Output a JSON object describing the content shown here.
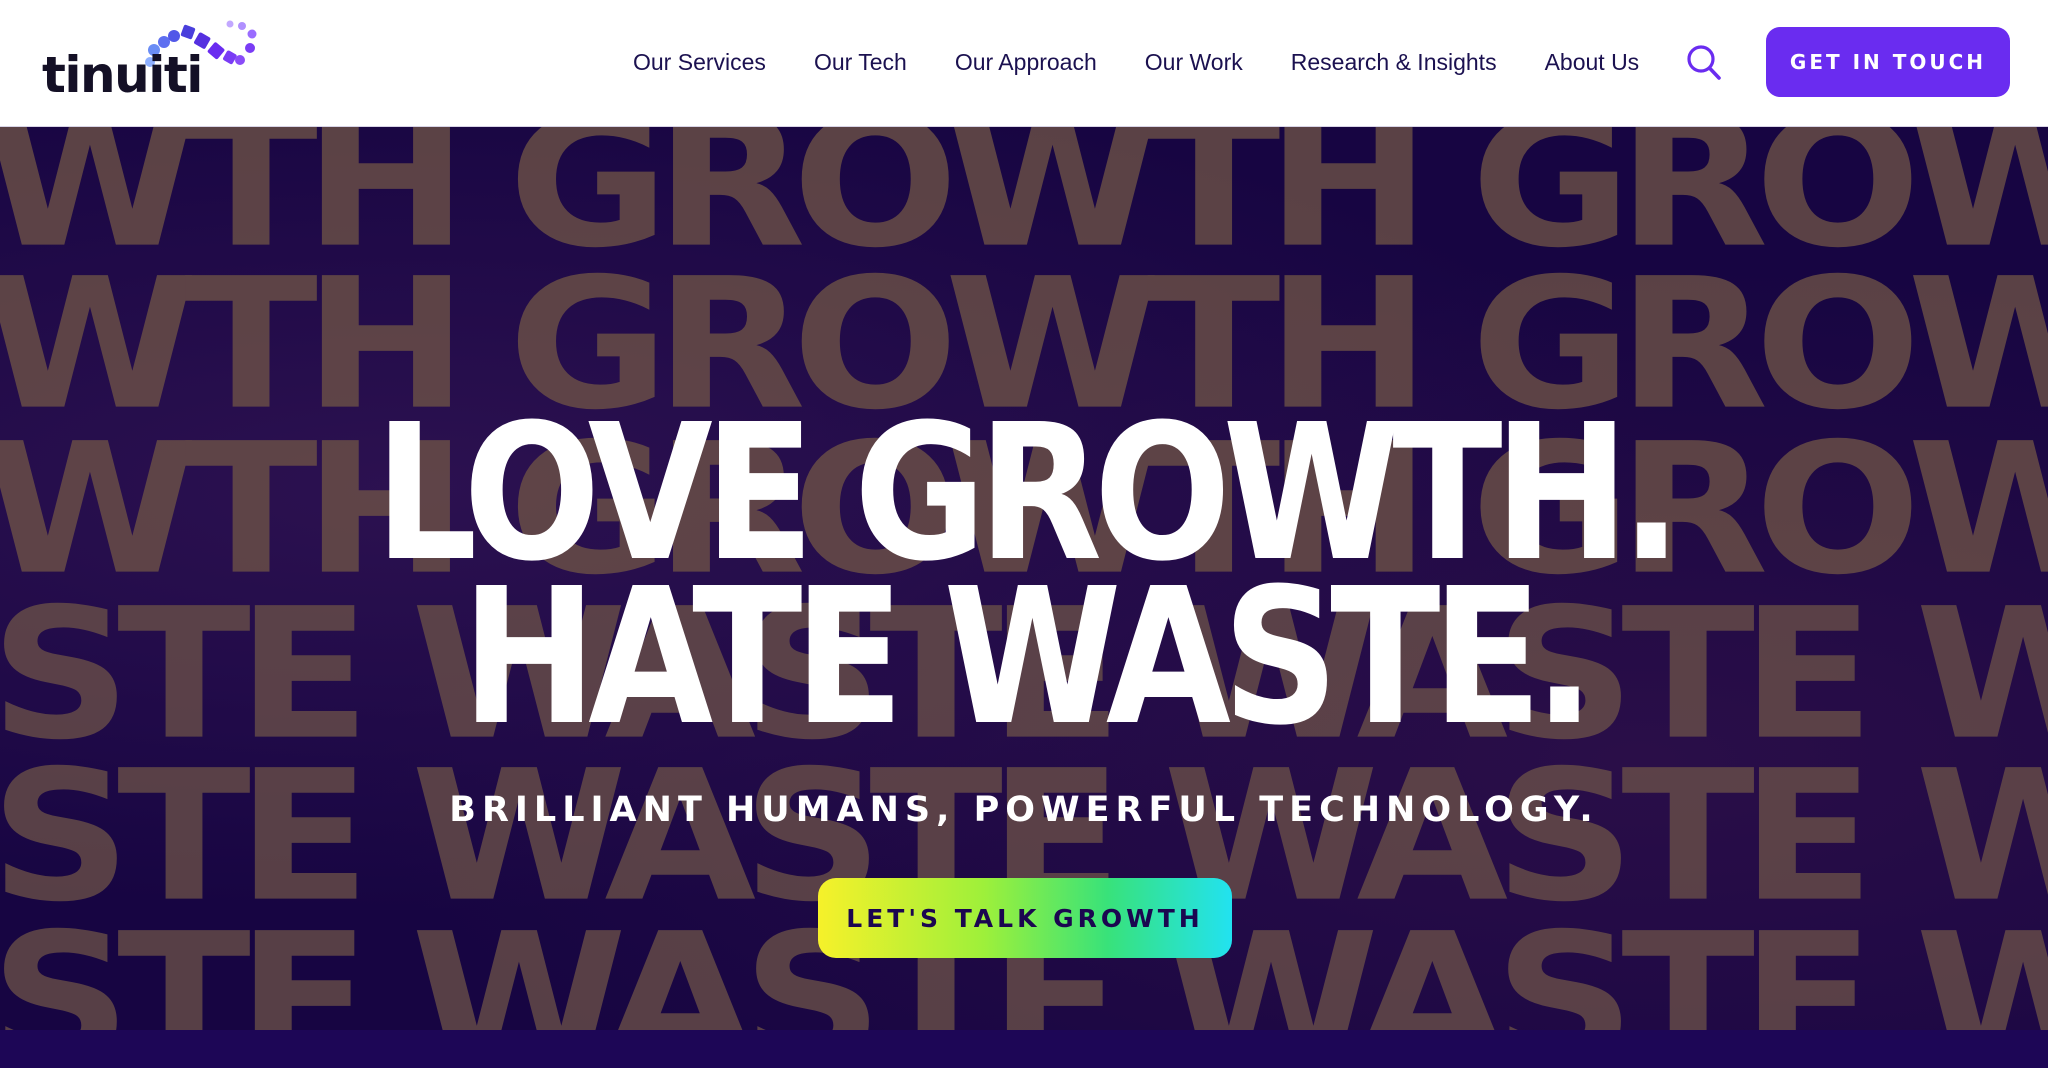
{
  "brand": {
    "logo_text": "tinuiti"
  },
  "nav": {
    "items": [
      {
        "label": "Our Services"
      },
      {
        "label": "Our Tech"
      },
      {
        "label": "Our Approach"
      },
      {
        "label": "Our Work"
      },
      {
        "label": "Research & Insights"
      },
      {
        "label": "About Us"
      }
    ],
    "search_icon": "search-icon",
    "cta_label": "GET IN TOUCH"
  },
  "hero": {
    "background_rows": [
      "WTH GROWTH GROWTH GROWTH GRO",
      "WTH GROWTH GROWTH GROWTH GRO",
      "WTH GROWTH GROWTH GROWTH GRO",
      "STE WASTE WASTE WASTE WASTE W",
      "STE WASTE WASTE WASTE WASTE W",
      "STE WASTE WASTE WASTE WASTE W"
    ],
    "headline_line1": "LOVE GROWTH.",
    "headline_line2": "HATE WASTE.",
    "subheadline": "BRILLIANT HUMANS, POWERFUL TECHNOLOGY.",
    "cta_label": "LET'S TALK GROWTH"
  },
  "colors": {
    "primary_purple": "#6a2cf0",
    "dark_navy": "#1b0650",
    "nav_text": "#1b1150",
    "cta_gradient": [
      "#f6f12a",
      "#38e27a",
      "#22e2f0"
    ]
  }
}
